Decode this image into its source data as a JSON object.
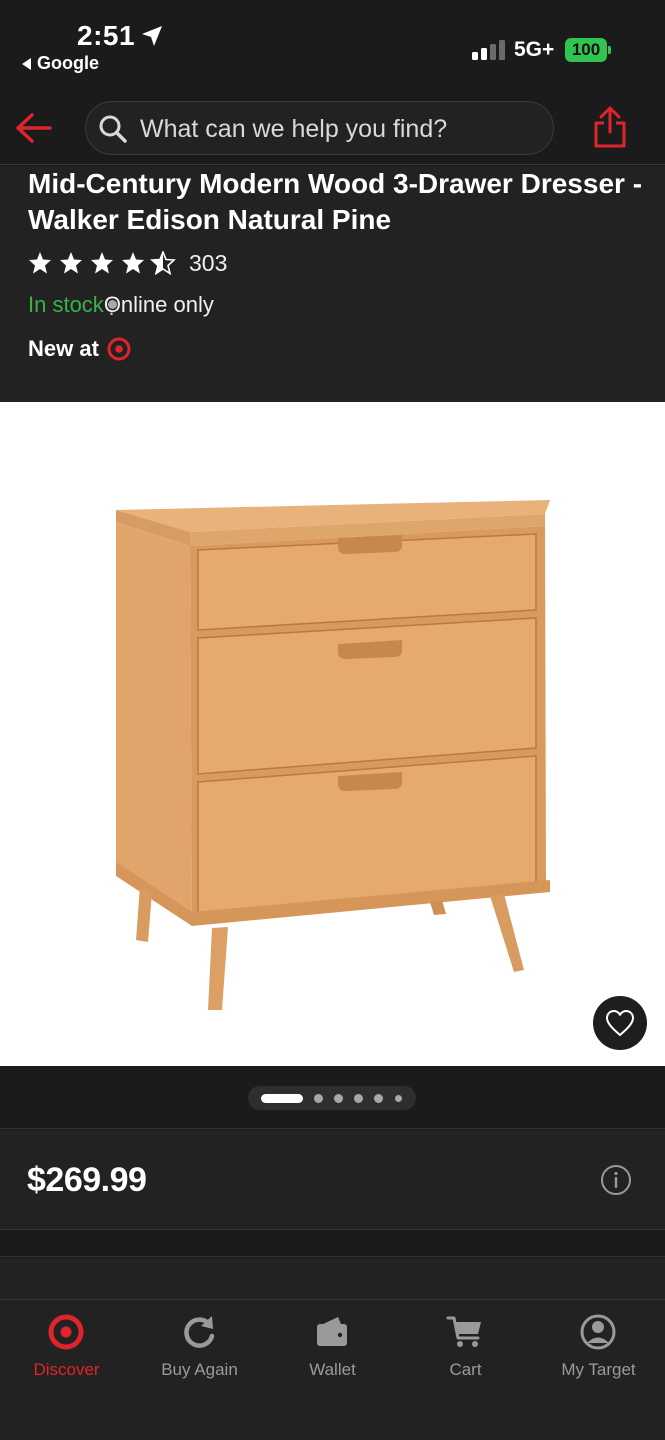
{
  "status_bar": {
    "time": "2:51",
    "back_app": "Google",
    "network": "5G+",
    "battery": "100"
  },
  "search": {
    "placeholder": "What can we help you find?"
  },
  "product": {
    "title": "Mid-Century Modern Wood 3-Drawer Dresser - Walker Edison Natural Pine",
    "rating": 4.5,
    "rating_count": "303",
    "stock_status": "In stock",
    "separator": "·",
    "availability": "Online only",
    "new_at": "New at",
    "price": "$269.99"
  },
  "carousel": {
    "total_images": 6,
    "active_index": 0
  },
  "nav": {
    "items": [
      {
        "label": "Discover",
        "icon": "target-bullseye-icon",
        "active": true
      },
      {
        "label": "Buy Again",
        "icon": "refresh-icon",
        "active": false
      },
      {
        "label": "Wallet",
        "icon": "wallet-icon",
        "active": false
      },
      {
        "label": "Cart",
        "icon": "cart-icon",
        "active": false
      },
      {
        "label": "My Target",
        "icon": "account-icon",
        "active": false
      }
    ]
  },
  "colors": {
    "brand_red": "#e0242b",
    "in_stock_green": "#38b24a",
    "background": "#1b1b1b",
    "battery_green": "#30c450"
  }
}
